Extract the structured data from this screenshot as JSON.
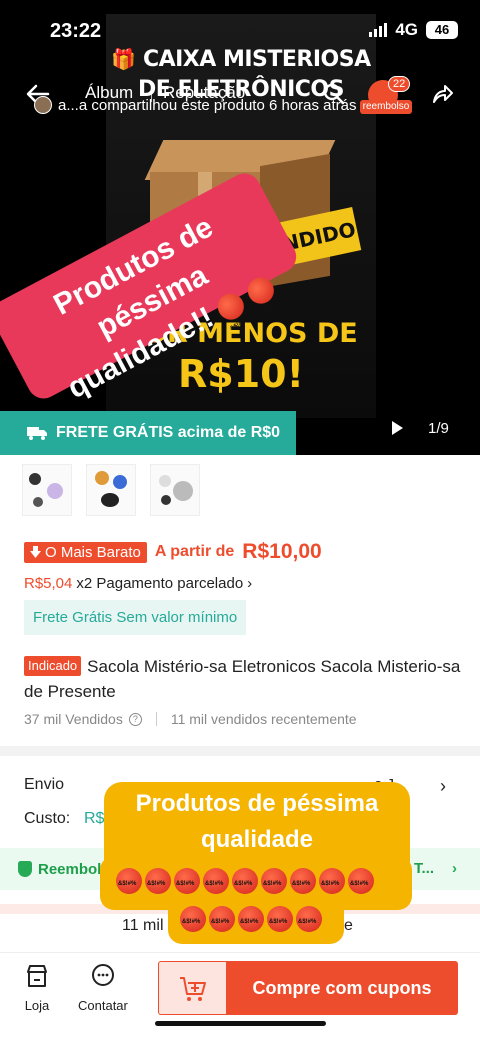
{
  "status_bar": {
    "time": "23:22",
    "network": "4G",
    "battery": "46"
  },
  "nav": {
    "tab_album": "Álbum",
    "tab_reputation": "Reputação",
    "cart_badge": "22",
    "cart_strip": "reembolso"
  },
  "share_notice": "a...a compartilhou este produto 6 horas atrás",
  "hero": {
    "poster_title_line1": "CAIXA MISTERIOSA",
    "poster_title_line2": "DE ELETRÔNICOS",
    "poster_banner": "REENDIDO",
    "poster_sub_line1": "POR MENOS DE",
    "poster_sub_line2": "R$10!",
    "counter": "1/9",
    "free_shipping": "FRETE GRÁTIS acima de R$0"
  },
  "overlay_red": {
    "line1": "Produtos de péssima",
    "line2": "qualidade!!"
  },
  "product": {
    "badge_cheap": "O Mais Barato",
    "price_prefix": "A partir de",
    "price": "R$10,00",
    "installment_amount": "R$5,04",
    "installment_text": "x2 Pagamento parcelado",
    "free_shipping_box": "Frete Grátis Sem valor mínimo",
    "tag": "Indicado",
    "title": "Sacola Mistério-sa Eletronicos Sacola Misterio-sa de Presente",
    "sold": "37 mil Vendidos",
    "sold_recent": "11 mil vendidos recentemente"
  },
  "shipping": {
    "label": "Envio",
    "destination": "o,J...",
    "cost_label": "Custo:",
    "cost_value": "R$"
  },
  "refund": {
    "label": "Reembol",
    "tail": "T..."
  },
  "reviews_row": {
    "left": "11 mil",
    "right": "e"
  },
  "overlay_yellow": {
    "line1": "Produtos de péssima",
    "line2": "qualidade"
  },
  "bottom_bar": {
    "store": "Loja",
    "contact": "Contatar",
    "buy": "Compre com cupons"
  },
  "colors": {
    "accent": "#ee4d2d",
    "teal": "#26aa99",
    "sticker_red": "#e8395a",
    "sticker_yellow": "#f4b400"
  },
  "icons": [
    "back-arrow-icon",
    "search-icon",
    "cart-icon",
    "share-icon",
    "truck-icon",
    "play-icon",
    "question-icon",
    "shield-icon",
    "store-icon",
    "chat-icon",
    "add-to-cart-icon",
    "angry-emoji-icon"
  ]
}
